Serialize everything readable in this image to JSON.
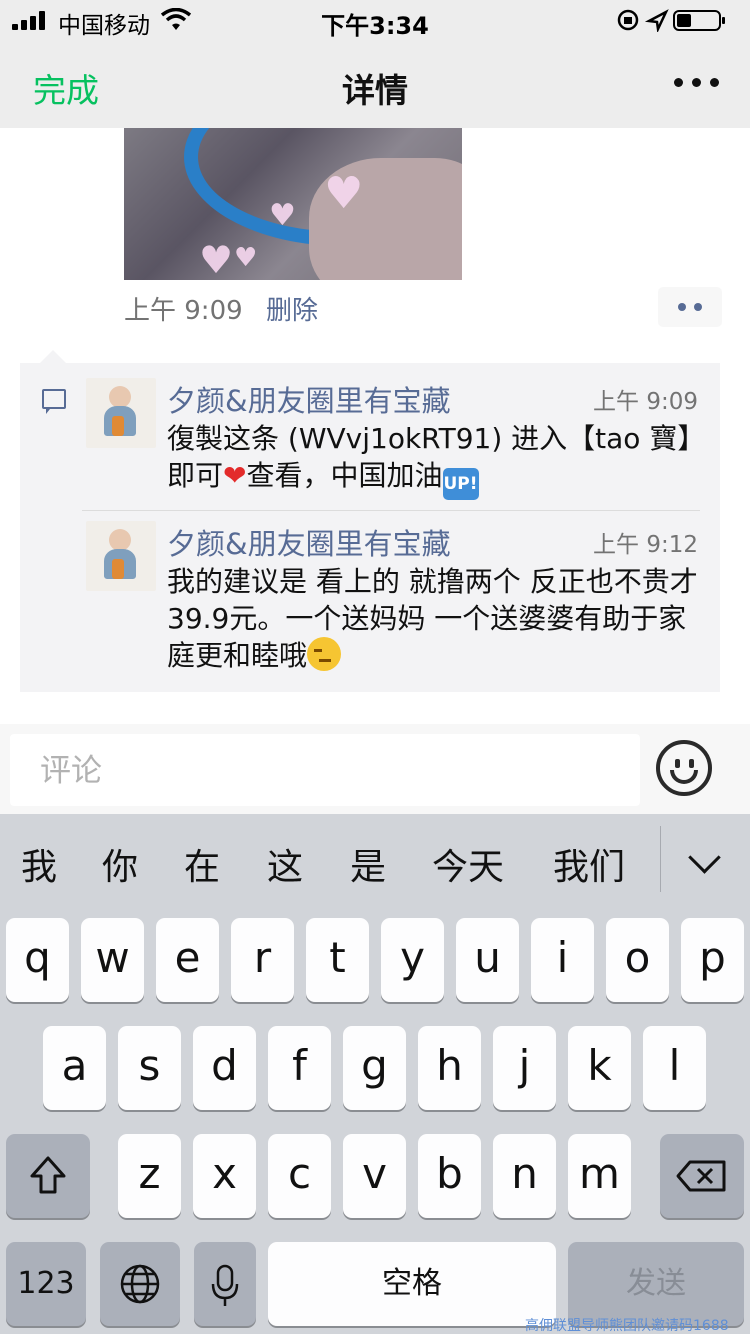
{
  "status": {
    "carrier": "中国移动",
    "time": "下午3:34"
  },
  "nav": {
    "done": "完成",
    "title": "详情"
  },
  "post": {
    "time": "上午 9:09",
    "delete": "删除"
  },
  "comments": [
    {
      "author": "夕颜&朋友圈里有宝藏",
      "time": "上午 9:09",
      "text_a": "復製这条 (WVvj1okRT91) 进入【tao 寶】即可",
      "emoji1": "❤",
      "text_b": "查看，中国加油",
      "emoji2": "UP!"
    },
    {
      "author": "夕颜&朋友圈里有宝藏",
      "time": "上午 9:12",
      "text": "我的建议是 看上的 就撸两个 反正也不贵才 39.9元。一个送妈妈 一个送婆婆有助于家庭更和睦哦"
    }
  ],
  "input": {
    "placeholder": "评论"
  },
  "keyboard": {
    "suggestions": [
      "我",
      "你",
      "在",
      "这",
      "是",
      "今天",
      "我们"
    ],
    "row1": [
      "q",
      "w",
      "e",
      "r",
      "t",
      "y",
      "u",
      "i",
      "o",
      "p"
    ],
    "row2": [
      "a",
      "s",
      "d",
      "f",
      "g",
      "h",
      "j",
      "k",
      "l"
    ],
    "row3": [
      "z",
      "x",
      "c",
      "v",
      "b",
      "n",
      "m"
    ],
    "numbers": "123",
    "space": "空格",
    "send": "发送"
  },
  "watermark": "高佣联盟导师熊团队邀请码1688"
}
